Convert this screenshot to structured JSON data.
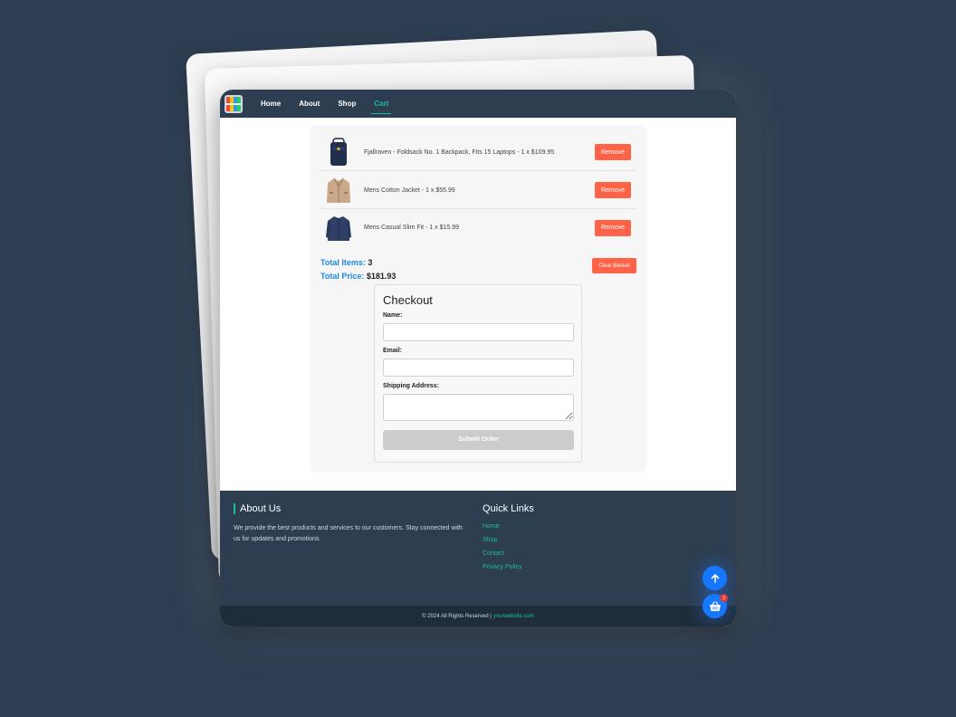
{
  "nav": {
    "links": [
      "Home",
      "About",
      "Shop",
      "Cart"
    ],
    "active": "Cart"
  },
  "cart": {
    "items": [
      {
        "description": "Fjallraven - Foldsack No. 1 Backpack, Fits 15 Laptops - 1 x $109.95",
        "icon": "backpack-icon"
      },
      {
        "description": "Mens Cotton Jacket - 1 x $55.99",
        "icon": "jacket-icon"
      },
      {
        "description": "Mens Casual Slim Fit - 1 x $15.99",
        "icon": "shirt-icon"
      }
    ],
    "remove_label": "Remove",
    "total_items_label": "Total Items:",
    "total_items_value": "3",
    "total_price_label": "Total Price:",
    "total_price_value": "$181.93",
    "clear_label": "Clear Basket"
  },
  "checkout": {
    "title": "Checkout",
    "name_label": "Name:",
    "name_value": "",
    "email_label": "Email:",
    "email_value": "",
    "address_label": "Shipping Address:",
    "address_value": "",
    "submit_label": "Submit Order"
  },
  "footer": {
    "about_title": "About Us",
    "about_text": "We provide the best products and services to our customers. Stay connected with us for updates and promotions.",
    "quick_title": "Quick Links",
    "quick_links": [
      "Home",
      "Shop",
      "Contact",
      "Privacy Policy"
    ],
    "copyright": "© 2024 All Rights Reserved |",
    "site_link": "yourwebsite.com"
  },
  "fab": {
    "cart_badge": "3"
  },
  "colors": {
    "accent": "#1abc9c",
    "danger": "#ff6347",
    "primary": "#1677ff",
    "navbar": "#2d3e50",
    "background": "#2e3e52"
  }
}
